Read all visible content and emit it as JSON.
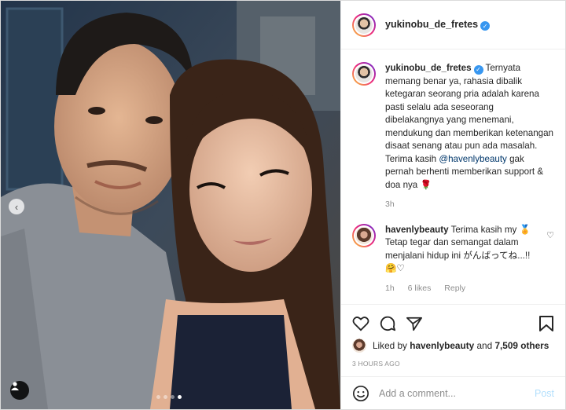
{
  "post": {
    "author": {
      "username": "yukinobu_de_fretes",
      "verified": true
    },
    "caption": {
      "username": "yukinobu_de_fretes",
      "text_1": "Ternyata memang benar ya, rahasia dibalik ketegaran seorang pria adalah karena pasti selalu ada seseorang dibelakangnya yang menemani, mendukung dan memberikan ketenangan disaat senang atau pun ada masalah. Terima kasih",
      "mention": "@havenlybeauty",
      "text_2": "gak pernah berhenti memberikan support & doa nya",
      "emoji": "🌹",
      "age": "3h"
    },
    "reply": {
      "username": "havenlybeauty",
      "text": "Terima kasih my 🏅 Tetap tegar dan semangat dalam menjalani hidup ini がんばってね...!! 🤗♡",
      "age": "1h",
      "likes": "6 likes",
      "reply_label": "Reply"
    },
    "likes": {
      "prefix": "Liked by",
      "user": "havenlybeauty",
      "middle": "and",
      "others": "7,509 others"
    },
    "timestamp": "3 HOURS AGO",
    "add_comment": {
      "placeholder": "Add a comment...",
      "post_label": "Post"
    },
    "carousel": {
      "count": 4,
      "active_index": 3
    }
  },
  "colors": {
    "verified": "#3897f0",
    "link": "#00376b",
    "muted": "#8e8e8e",
    "post_disabled": "#b2dffc"
  },
  "icons": [
    "chevron-left-icon",
    "user-tag-icon",
    "heart-icon",
    "comment-icon",
    "share-icon",
    "bookmark-icon",
    "emoji-icon",
    "verified-icon"
  ]
}
